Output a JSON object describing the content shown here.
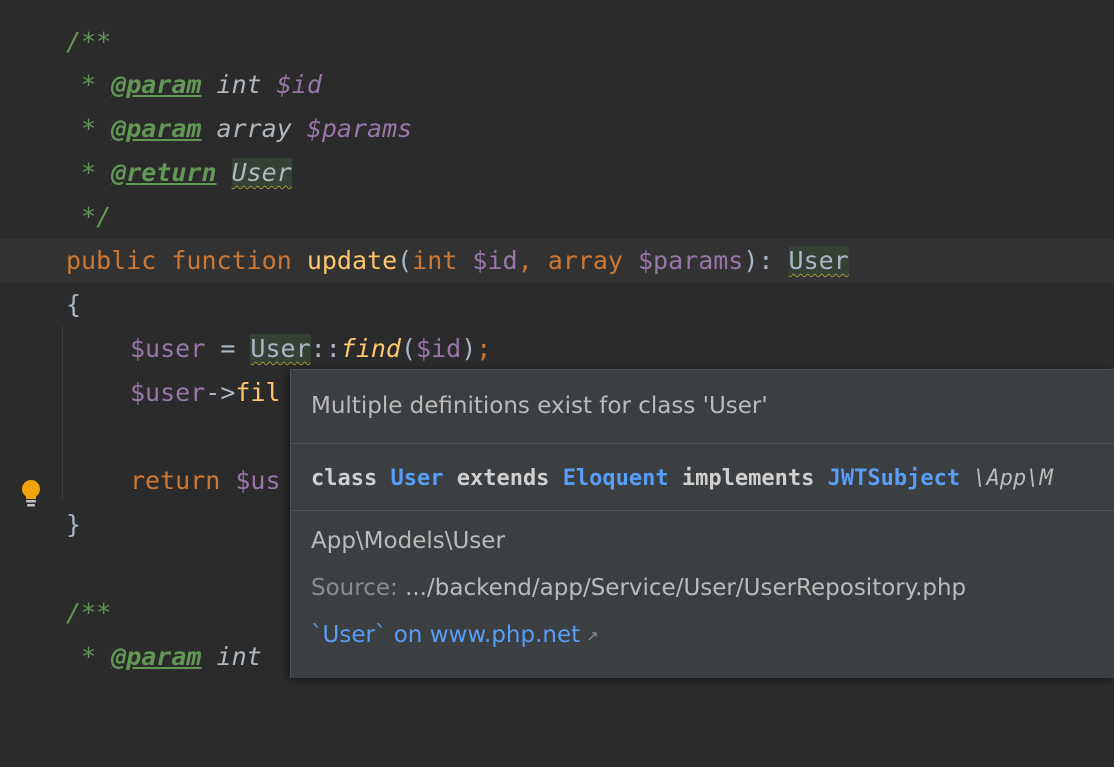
{
  "code": {
    "doc_open": "/**",
    "param1": {
      "star": " * ",
      "tag": "@param",
      "type": " int ",
      "var": "$id"
    },
    "param2": {
      "star": " * ",
      "tag": "@param",
      "type": " array ",
      "var": "$params"
    },
    "return": {
      "star": " * ",
      "tag": "@return",
      "type_sp": " ",
      "type": "User"
    },
    "doc_close": " */",
    "signature": {
      "kw_public": "public",
      "kw_function": " function ",
      "name": "update",
      "paren_open": "(",
      "t1": "int",
      "v1": " $id",
      "comma": ", ",
      "t2": "array",
      "v2": " $params",
      "paren_close": "): ",
      "ret": "User"
    },
    "brace_open": "{",
    "stmt1": {
      "var": "$user",
      "eq": " = ",
      "cls": "User",
      "op": "::",
      "fn": "find",
      "args_open": "(",
      "arg": "$id",
      "args_close": ")",
      "semi": ";"
    },
    "stmt2": {
      "var": "$user",
      "arrow": "->",
      "rest": "fil"
    },
    "stmt3": {
      "kw": "return",
      "rest": " $us"
    },
    "brace_close": "}",
    "doc2_open": "/**",
    "param3": {
      "star": " * ",
      "tag": "@param",
      "type": " int"
    }
  },
  "popup": {
    "header": "Multiple definitions exist for class 'User'",
    "sig": {
      "kw_class": "class ",
      "name": "User",
      "kw_extends": " extends ",
      "parent": "Eloquent",
      "kw_implements": " implements ",
      "iface": "JWTSubject",
      "ns": " \\App\\M"
    },
    "fqn": "App\\Models\\User",
    "source_label": "Source: ",
    "source_path": ".../backend/app/Service/User/UserRepository.php",
    "doc_link": "`User` on www.php.net"
  },
  "colors": {
    "background": "#2b2b2b",
    "keyword": "#cc7832",
    "function": "#ffc66d",
    "variable": "#9876aa",
    "comment": "#629755",
    "link": "#589df6",
    "popup_bg": "#3c3f41"
  }
}
